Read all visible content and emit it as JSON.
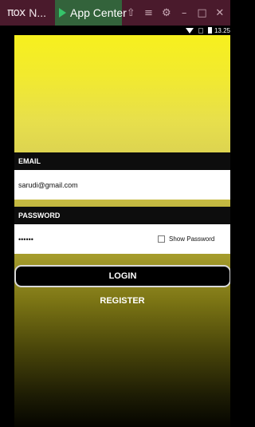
{
  "emulator": {
    "tabs": [
      {
        "label": "NOX N...",
        "logo_text": "ποx",
        "title": "N..."
      },
      {
        "label": "App Center",
        "icon": "play-icon"
      }
    ],
    "toolbar_icons": [
      {
        "name": "shirt-icon",
        "glyph": "⇧"
      },
      {
        "name": "menu-icon",
        "glyph": "≡"
      },
      {
        "name": "gear-icon",
        "glyph": "⚙"
      },
      {
        "name": "minimize-icon",
        "glyph": "–"
      },
      {
        "name": "maximize-icon",
        "glyph": "□"
      },
      {
        "name": "close-icon",
        "glyph": "✕"
      }
    ],
    "accent_color": "#4a1a2c",
    "app_tab_color": "#33633b"
  },
  "status_bar": {
    "time": "13.25",
    "icons": [
      "wifi-icon",
      "signal-icon",
      "battery-icon"
    ]
  },
  "login_form": {
    "email_label": "EMAIL",
    "email_value": "sarudi@gmail.com",
    "password_label": "PASSWORD",
    "password_value": "••••••",
    "show_password_label": "Show Password",
    "show_password_checked": false,
    "login_button_label": "LOGIN",
    "register_button_label": "REGISTER"
  },
  "colors": {
    "background_top": "#f7f01e",
    "background_bottom": "#050500",
    "label_bar": "#0d0d0d",
    "button": "#000000"
  }
}
